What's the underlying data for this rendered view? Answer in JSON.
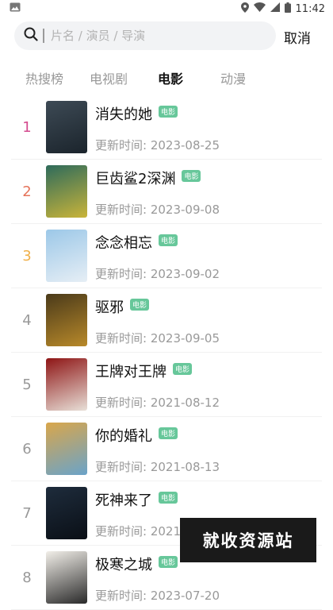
{
  "status_bar": {
    "time": "11:42"
  },
  "search": {
    "placeholder": "片名 / 演员 / 导演",
    "cancel_label": "取消"
  },
  "tabs": [
    {
      "label": "热搜榜",
      "active": false
    },
    {
      "label": "电视剧",
      "active": false
    },
    {
      "label": "电影",
      "active": true
    },
    {
      "label": "动漫",
      "active": false
    }
  ],
  "list": [
    {
      "rank": "1",
      "title": "消失的她",
      "badge": "电影",
      "update": "更新时间: 2023-08-25",
      "rank_color": "#d44b8f",
      "poster_colors": [
        "#3d4a55",
        "#1b242c"
      ]
    },
    {
      "rank": "2",
      "title": "巨齿鲨2深渊",
      "badge": "电影",
      "update": "更新时间: 2023-09-08",
      "rank_color": "#e5735a",
      "poster_colors": [
        "#2e6b5b",
        "#c9b43a"
      ]
    },
    {
      "rank": "3",
      "title": "念念相忘",
      "badge": "电影",
      "update": "更新时间: 2023-09-02",
      "rank_color": "#f0b04a",
      "poster_colors": [
        "#9cc8e8",
        "#e6eef5"
      ]
    },
    {
      "rank": "4",
      "title": "驱邪",
      "badge": "电影",
      "update": "更新时间: 2023-09-05",
      "rank_color": "#999999",
      "poster_colors": [
        "#4a3a1a",
        "#b8892a"
      ]
    },
    {
      "rank": "5",
      "title": "王牌对王牌",
      "badge": "电影",
      "update": "更新时间: 2021-08-12",
      "rank_color": "#999999",
      "poster_colors": [
        "#8e1515",
        "#e8e0d8"
      ]
    },
    {
      "rank": "6",
      "title": "你的婚礼",
      "badge": "电影",
      "update": "更新时间: 2021-08-13",
      "rank_color": "#999999",
      "poster_colors": [
        "#d9a64b",
        "#6aa3c9"
      ]
    },
    {
      "rank": "7",
      "title": "死神来了",
      "badge": "电影",
      "update": "更新时间: 2021-08-11",
      "rank_color": "#999999",
      "poster_colors": [
        "#1e2c3c",
        "#0a0f16"
      ]
    },
    {
      "rank": "8",
      "title": "极寒之城",
      "badge": "电影",
      "update": "更新时间: 2023-07-20",
      "rank_color": "#999999",
      "poster_colors": [
        "#f2efe9",
        "#2a2a2a"
      ]
    }
  ],
  "watermark": {
    "text": "就收资源站"
  }
}
